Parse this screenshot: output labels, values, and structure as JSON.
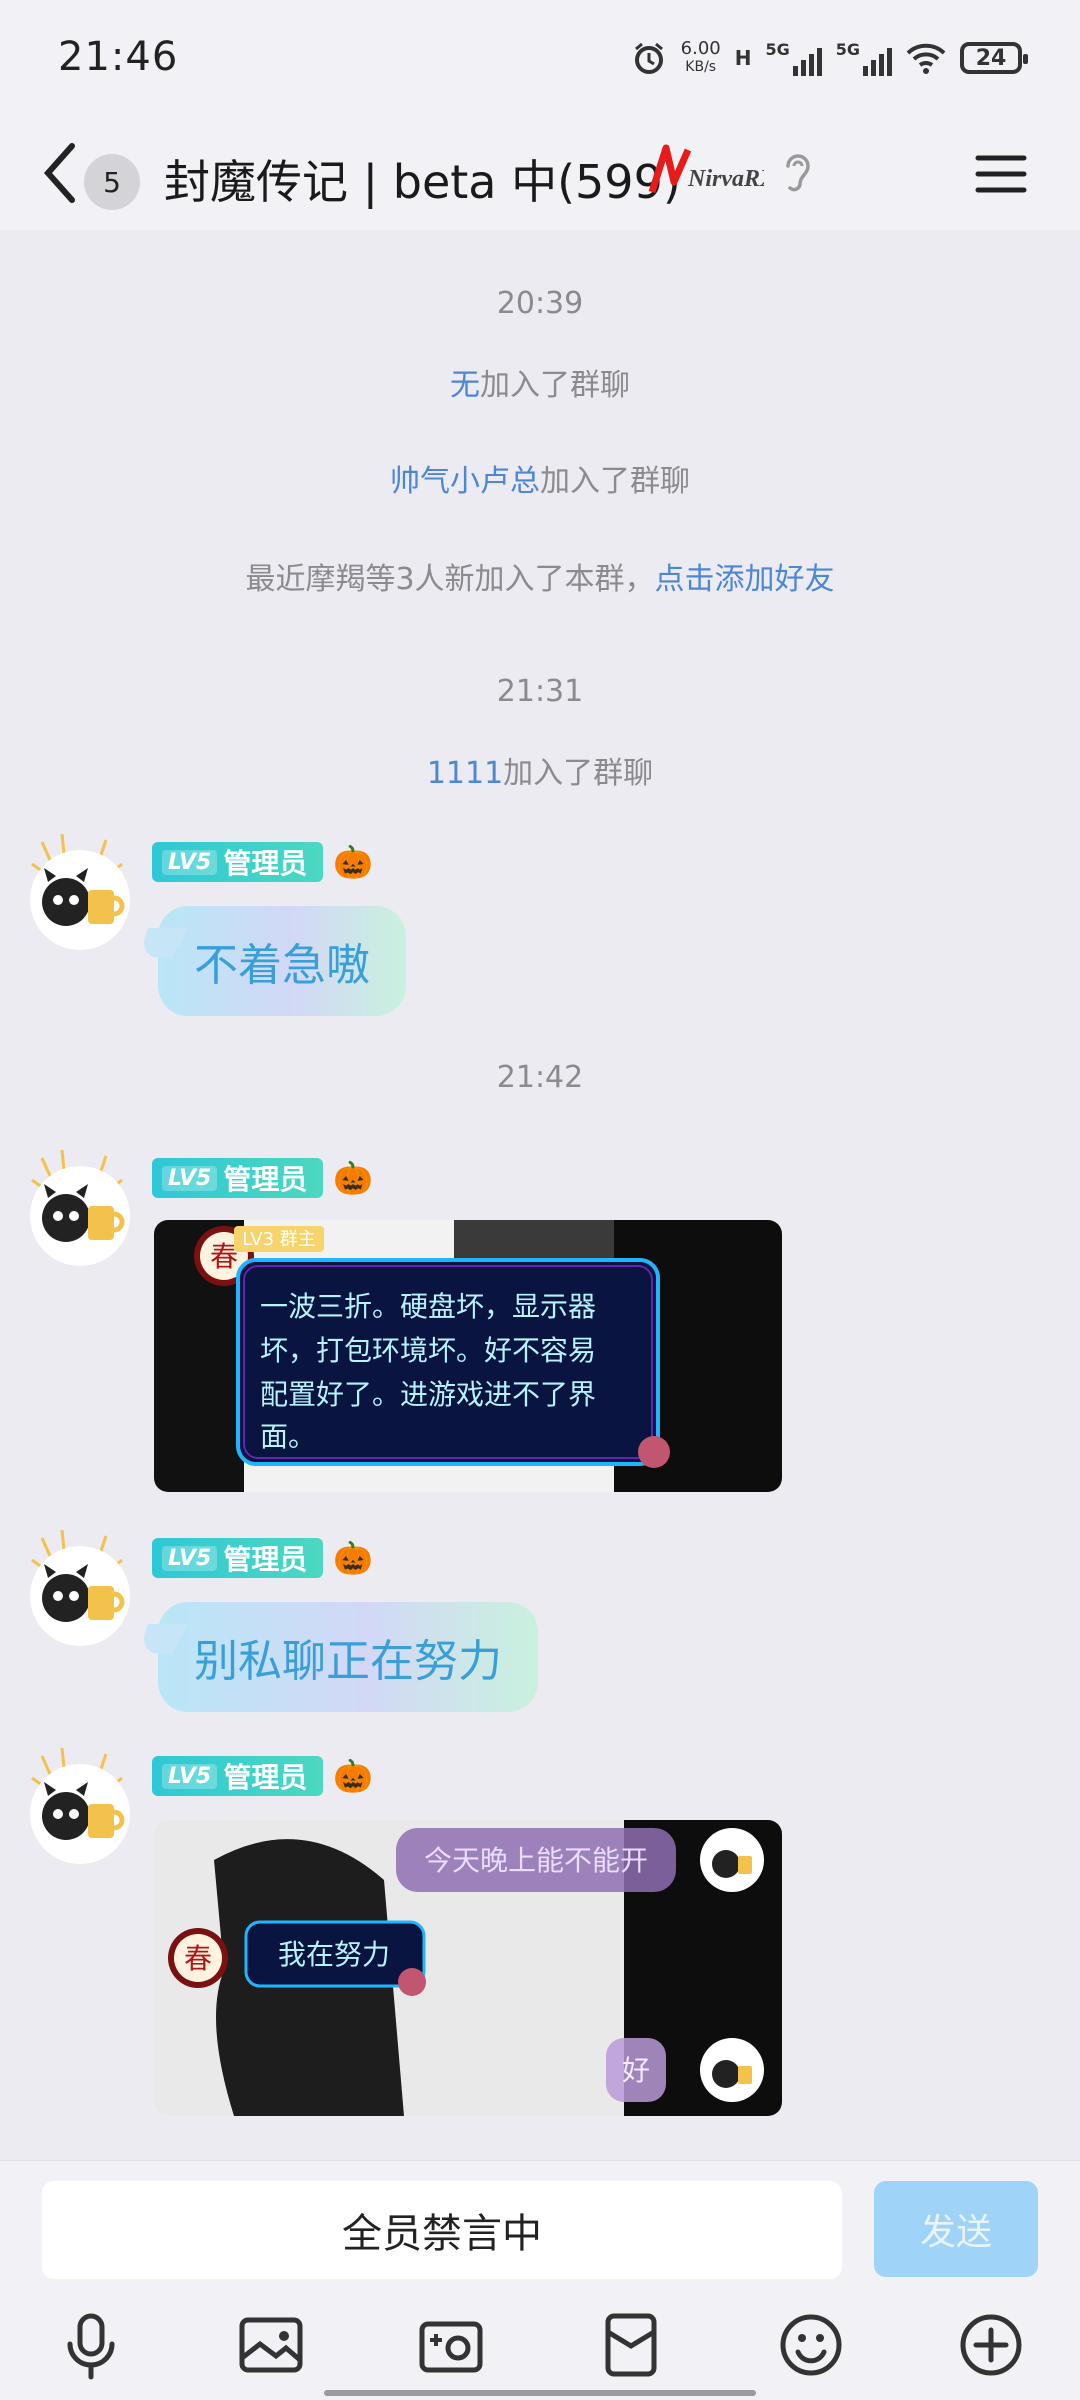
{
  "status_bar": {
    "time": "21:46",
    "net_speed": "6.00",
    "net_unit": "KB/s",
    "h_label": "H",
    "sig1": "5G",
    "sig2": "5G",
    "battery": "24"
  },
  "header": {
    "unread_count": "5",
    "title": "封魔传记 | beta 中(599)",
    "brand_logo_text": "NirvaRX"
  },
  "chat": {
    "ts1": "20:39",
    "join1_name": "无",
    "join1_text": "加入了群聊",
    "join2_name": "帅气小卢总",
    "join2_text": "加入了群聊",
    "recent_text": "最近摩羯等3人新加入了本群，",
    "recent_link": "点击添加好友",
    "ts2": "21:31",
    "join3_name": "1111",
    "join3_text": "加入了群聊",
    "ts3": "21:42",
    "messages": [
      {
        "lv": "LV5",
        "role": "管理员",
        "emoji": "🎃",
        "text": "不着急嗷"
      },
      {
        "lv": "LV5",
        "role": "管理员",
        "emoji": "🎃"
      },
      {
        "lv": "LV5",
        "role": "管理员",
        "emoji": "🎃",
        "text": "别私聊正在努力"
      },
      {
        "lv": "LV5",
        "role": "管理员",
        "emoji": "🎃"
      }
    ],
    "image1": {
      "badge": "LV3 群主",
      "seal": "春",
      "text_lines": [
        "一波三折。硬盘坏，显示器",
        "坏，打包环境坏。好不容易",
        "配置好了。进游戏进不了界",
        "面。"
      ]
    },
    "image2": {
      "seal": "春",
      "top_right": "今天晚上能不能开",
      "mid_left": "我在努力",
      "bottom_right": "好"
    }
  },
  "input": {
    "muted_text": "全员禁言中",
    "send_label": "发送"
  },
  "toolbar": {
    "icons": [
      "microphone-icon",
      "photo-icon",
      "camera-icon",
      "red-packet-icon",
      "emoji-icon",
      "plus-icon"
    ]
  }
}
